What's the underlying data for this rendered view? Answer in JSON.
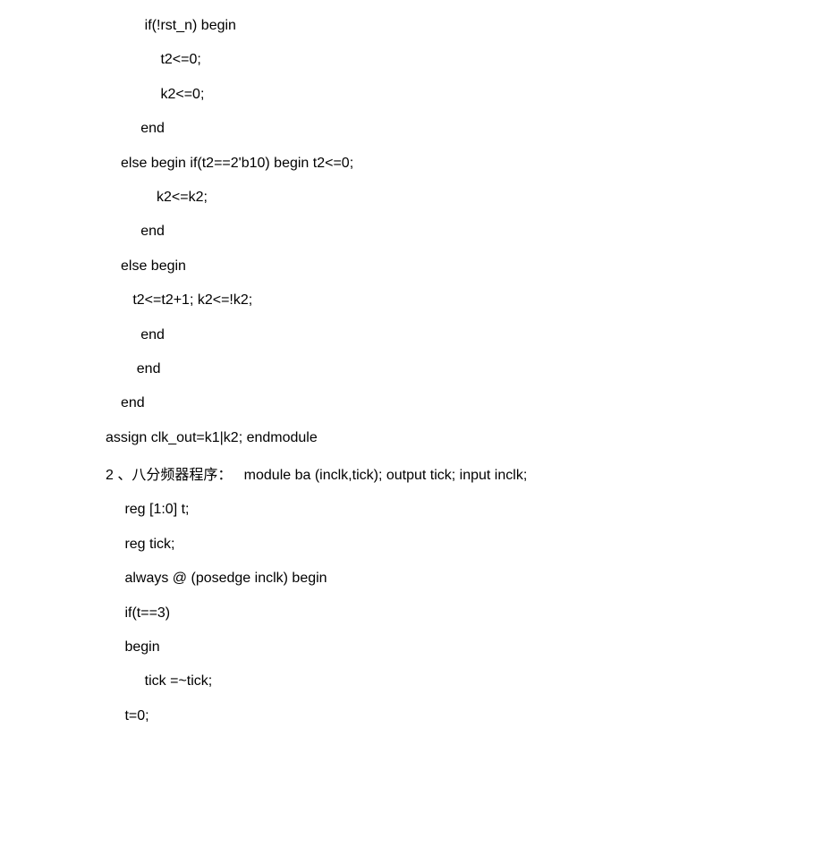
{
  "lines": [
    "      if(!rst_n) begin",
    "          t2<=0;",
    "          k2<=0;",
    "     end",
    "else begin if(t2==2'b10) begin t2<=0;",
    "         k2<=k2;",
    "     end",
    "else begin",
    "   t2<=t2+1; k2<=!k2;",
    "     end",
    "    end",
    "end"
  ],
  "assign_line": "assign clk_out=k1|k2; endmodule",
  "section2_heading": "2 、八分频器程序：   module ba (inclk,tick); output tick; input inclk;",
  "lines2": [
    " reg [1:0] t;",
    " reg tick;",
    " always @ (posedge inclk) begin",
    " if(t==3)",
    " begin",
    "      tick =~tick;",
    " t=0;"
  ]
}
